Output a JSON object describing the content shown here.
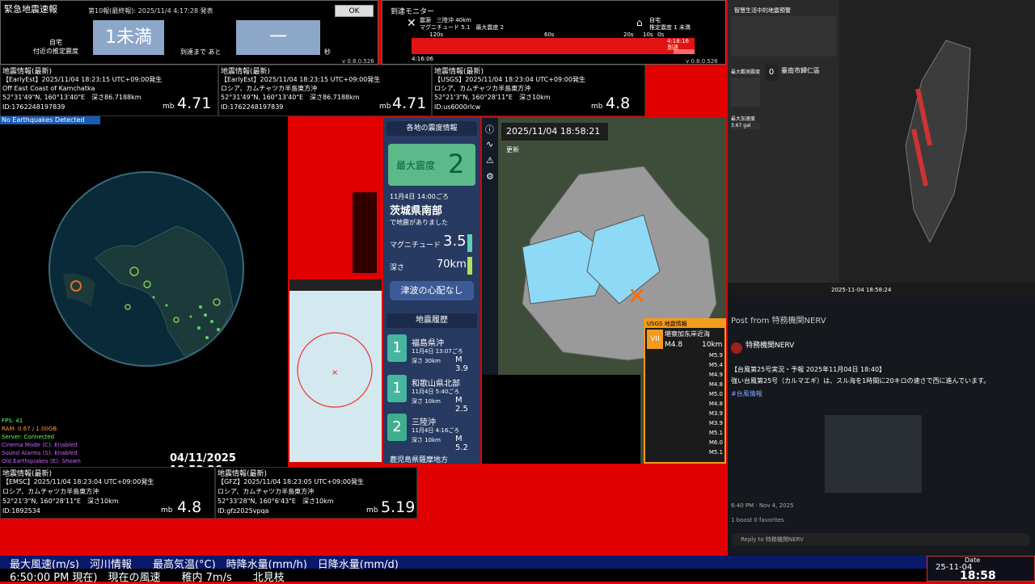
{
  "eew": {
    "title": "緊急地震速報",
    "report": "第10報(最終報): 2025/11/4 4:17:28 発表",
    "ok": "OK",
    "home_label": "自宅\n付近の推定震度",
    "shindo": "1未満",
    "until_label": "到達まで あと",
    "count": "一",
    "sec": "秒",
    "version": "v 0.8.0.526"
  },
  "monitor": {
    "title": "到達モニター",
    "quake": "震源　三陸沖 40km\nマグニチュード 5.1　最大震度 2",
    "home": "自宅\n推定震度 1 未満",
    "ticks": [
      "120s",
      "60s",
      "20s",
      "10s",
      "0s"
    ],
    "t_start": "4:16:06",
    "t_end": "4:18:16\n到達",
    "version": "v 0.8.0.526"
  },
  "info": [
    {
      "hd": "地震情報(最新)",
      "l1": "【EarlyEst】2025/11/04  18:23:15  UTC+09:00発生",
      "l2": "Off East Coast of Kamchatka",
      "l3": "52°31'49\"N, 160°13'40\"E　深さ86.7188km",
      "l4": "ID:1762248197839",
      "mag": "4.71"
    },
    {
      "hd": "地震情報(最新)",
      "l1": "【EarlyEst】2025/11/04  18:23:15  UTC+09:00発生",
      "l2": "ロシア、カムチャツカ半島東方沖",
      "l3": "52°31'49\"N, 160°13'40\"E　深さ86.7188km",
      "l4": "ID:1762248197839",
      "mag": "4.71"
    },
    {
      "hd": "地震情報(最新)",
      "l1": "【USGS】2025/11/04  18:23:04  UTC+09:00発生",
      "l2": "ロシア、カムチャツカ半島東方沖",
      "l3": "52°21'3\"N, 160°28'11\"E　深さ10km",
      "l4": "ID:us6000rlcw",
      "mag": "4.8"
    },
    {
      "hd": "地震情報(最新)",
      "l1": "【EMSC】2025/11/04  18:23:04  UTC+09:00発生",
      "l2": "ロシア、カムチャツカ半島東方沖",
      "l3": "52°21'3\"N, 160°28'11\"E　深さ10km",
      "l4": "ID:1892534",
      "mag": "4.8"
    },
    {
      "hd": "地震情報(最新)",
      "l1": "【GFZ】2025/11/04  18:23:05  UTC+09:00発生",
      "l2": "ロシア、カムチャツカ半島東方沖",
      "l3": "52°33'28\"N, 160°6'43\"E　深さ10km",
      "l4": "ID:gfz2025vpqa",
      "mag": "5.19"
    }
  ],
  "mb": "mb",
  "globe": {
    "no_eq": "No Earthquakes Detected",
    "stats": [
      "FPS: 41",
      "RAM: 0.67 / 1.00GB",
      "Server: Connected",
      "Cinema Mode (C): Enabled",
      "Sound Alarms (S): Enabled",
      "Old Earthquakes (E): Shown"
    ],
    "date": "04/11/2025 18:58:26"
  },
  "seis": {
    "header": "各地の震度情報",
    "max_label": "最大震度",
    "max_value": "2",
    "time": "11月4日 14:00ごろ",
    "place": "茨城県南部",
    "happened": "で地震がありました",
    "mag_label": "マグニチュード",
    "mag_value": "3.5",
    "depth_label": "深さ",
    "depth_value": "70km",
    "tsunami": "津波の心配なし",
    "history_title": "地震履歴",
    "history": [
      {
        "intensity": "1",
        "place": "福島県沖",
        "time": "11月4日 13:07ごろ",
        "depth": "深さ 30km",
        "mag": "M 3.9"
      },
      {
        "intensity": "1",
        "place": "和歌山県北部",
        "time": "11月4日 5:40ごろ",
        "depth": "深さ 10km",
        "mag": "M 2.5"
      },
      {
        "intensity": "2",
        "place": "三陸沖",
        "time": "11月4日 4:16ごろ",
        "depth": "深さ 10km",
        "mag": "M 5.2"
      }
    ],
    "history_next": "鹿児島県薩摩地方",
    "map_time": "2025/11/04  18:58:21",
    "map_update": "更新"
  },
  "usgs": {
    "title": "USGS 地震情報",
    "grade": "VII",
    "place": "堪察加东岸近海",
    "mag": "M4.8",
    "depth": "10km",
    "list": [
      "M5.9",
      "M5.4",
      "M4.9",
      "M4.8",
      "M5.0",
      "M4.8",
      "M3.9",
      "M3.9",
      "M5.1",
      "M6.0",
      "M5.1"
    ]
  },
  "taiwan": {
    "title": "智慧生活中的地震預警",
    "max_label": "最大觀測震度",
    "max_value": "0",
    "station": "臺南市歸仁區",
    "accel_label": "最大加速度",
    "accel_value": "3.67 gal",
    "scale": [
      "7",
      "6",
      "5",
      "4",
      "3",
      "2",
      "1"
    ],
    "timestamp": "2025-11-04 18:58:24"
  },
  "feed": {
    "post_from": "Post from 特務機関NERV",
    "author": "特務機関NERV",
    "text1": "【台風第25号実況・予報 2025年11月04日 18:40】",
    "text2": "強い台風第25号（カルマエギ）は、スル海を1時間に20キロの速さで西に進んでいます。",
    "tag": "#台風情報",
    "time": "6:40 PM · Nov 4, 2025",
    "stats": "1 boost  0 favorites",
    "reply": "Reply to 特務機関NERV"
  },
  "ticker1": "最大風速(m/s)　河川情報　　最高気温(°C)　時降水量(mm/h)　日降水量(mm/d)",
  "ticker2": "6:50:00 PM 現在)　現在の風速　　稚内 7m/s　　北見枝",
  "clock": {
    "label": "Date",
    "date": "25-11-04",
    "time": "18:58"
  }
}
